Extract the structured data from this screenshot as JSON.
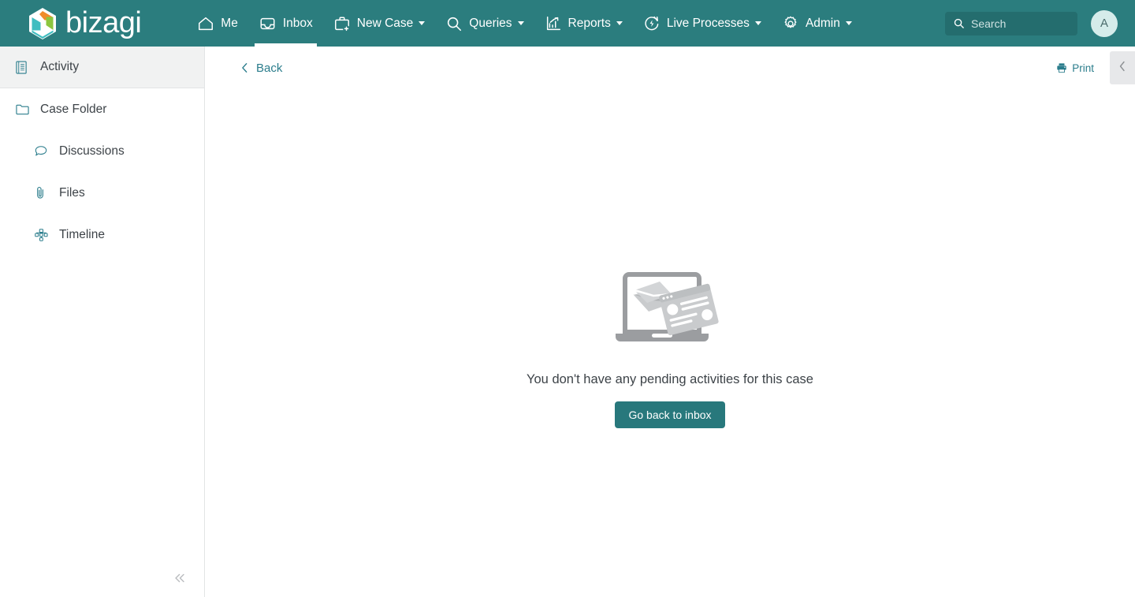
{
  "header": {
    "brand_name": "bizagi",
    "logo_icon": "bizagi-hexagon-logo",
    "nav": [
      {
        "label": "Me",
        "icon": "home-icon",
        "active": false,
        "has_caret": false
      },
      {
        "label": "Inbox",
        "icon": "inbox-tray-icon",
        "active": true,
        "has_caret": false
      },
      {
        "label": "New Case",
        "icon": "briefcase-plus-icon",
        "active": false,
        "has_caret": true
      },
      {
        "label": "Queries",
        "icon": "search-icon",
        "active": false,
        "has_caret": true
      },
      {
        "label": "Reports",
        "icon": "bar-chart-icon",
        "active": false,
        "has_caret": true
      },
      {
        "label": "Live Processes",
        "icon": "refresh-bolt-icon",
        "active": false,
        "has_caret": true
      },
      {
        "label": "Admin",
        "icon": "gear-icon",
        "active": false,
        "has_caret": true
      }
    ],
    "search": {
      "placeholder": "Search",
      "icon": "search-icon",
      "value": ""
    },
    "avatar": {
      "initial": "A"
    }
  },
  "sidebar": {
    "items": [
      {
        "label": "Activity",
        "icon": "document-list-icon",
        "active": true,
        "sub": false
      },
      {
        "label": "Case Folder",
        "icon": "folder-icon",
        "active": false,
        "sub": false
      },
      {
        "label": "Discussions",
        "icon": "chat-bubble-icon",
        "active": false,
        "sub": true
      },
      {
        "label": "Files",
        "icon": "paperclip-icon",
        "active": false,
        "sub": true
      },
      {
        "label": "Timeline",
        "icon": "sitemap-icon",
        "active": false,
        "sub": true
      }
    ],
    "collapse_icon": "double-chevron-left-icon"
  },
  "toolbar": {
    "back_label": "Back",
    "back_icon": "chevron-left-icon",
    "print_label": "Print",
    "print_icon": "printer-icon",
    "panel_toggle_icon": "chevron-left-icon"
  },
  "empty_state": {
    "illustration_icon": "laptop-envelope-illustration",
    "message": "You don't have any pending activities for this case",
    "button_label": "Go back to inbox"
  },
  "colors": {
    "header_teal": "#2b7d7e",
    "search_teal": "#246d6e",
    "accent_link": "#2b7d8c",
    "button_teal": "#28787c",
    "avatar_bg": "#d5ecea",
    "sidebar_active_bg": "#f1f2f2",
    "text_dark": "#3d4348",
    "illustration_gray": "#9b9da0",
    "logo_orange": "#f08c2b",
    "logo_green": "#8cc63f",
    "logo_cyan": "#3fbdc0"
  }
}
